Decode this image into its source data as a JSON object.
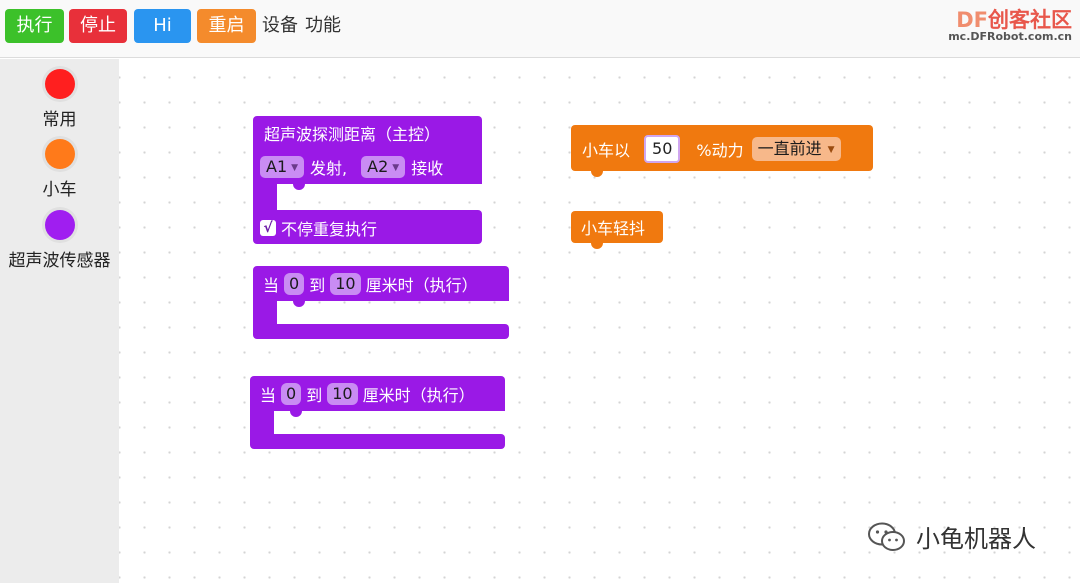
{
  "toolbar": {
    "buttons": [
      {
        "label": "执行",
        "color": "#3cc12a"
      },
      {
        "label": "停止",
        "color": "#e8303a"
      },
      {
        "label": "Hi",
        "color": "#2a95f0"
      },
      {
        "label": "重启",
        "color": "#f48b2c"
      }
    ],
    "menus": [
      "设备",
      "功能"
    ],
    "logo_df": "DF",
    "logo_text": "创客社区",
    "logo_url": "mc.DFRobot.com.cn"
  },
  "sidebar": {
    "categories": [
      {
        "label": "常用",
        "color": "#ff1f1f"
      },
      {
        "label": "小车",
        "color": "#ff7a1a"
      },
      {
        "label": "超声波传感器",
        "color": "#a01ef0"
      }
    ]
  },
  "blocks": {
    "ultrasonic": {
      "title": "超声波探测距离（主控）",
      "trig_pin": "A1",
      "emit_label": "发射,",
      "echo_pin": "A2",
      "receive_label": "接收",
      "check": "√",
      "repeat_label": "不停重复执行"
    },
    "range1": {
      "prefix": "当",
      "from": "0",
      "to_label": "到",
      "to": "10",
      "suffix": "厘米时（执行）"
    },
    "range2": {
      "prefix": "当",
      "from": "0",
      "to_label": "到",
      "to": "10",
      "suffix": "厘米时（执行）"
    },
    "car_forward": {
      "prefix": "小车以",
      "power": "50",
      "unit": "%动力",
      "direction": "一直前进"
    },
    "car_shake": {
      "label": "小车轻抖"
    }
  },
  "colors": {
    "ultrasonic_block": "#9a19e6",
    "car_block": "#f0790f"
  },
  "watermark": {
    "text": "小龟机器人"
  }
}
